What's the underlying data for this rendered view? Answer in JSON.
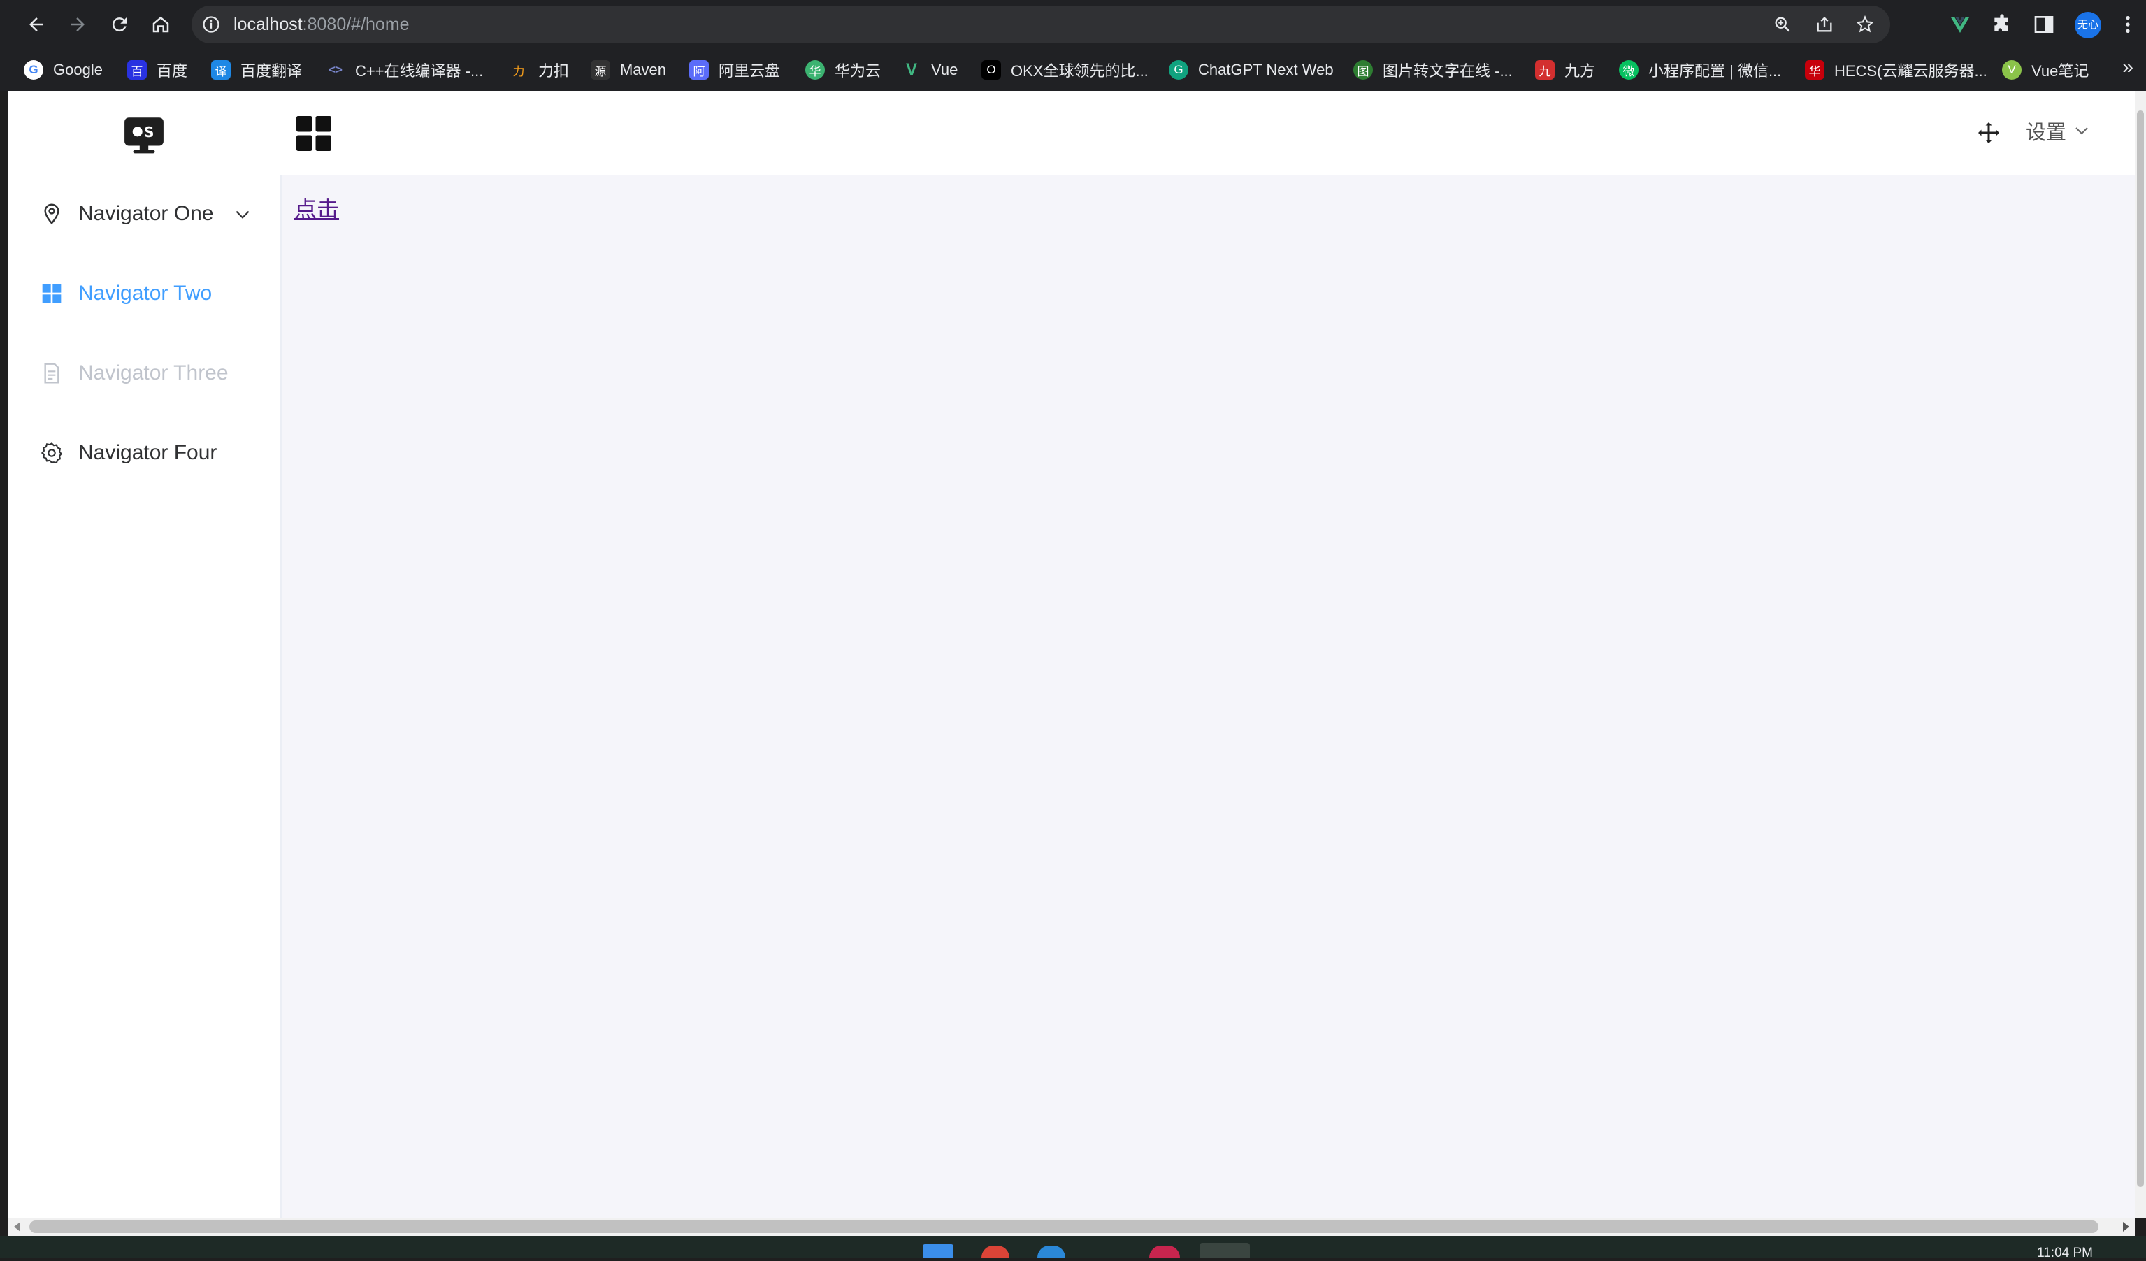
{
  "browser": {
    "url_host": "localhost",
    "url_rest": ":8080/#/home",
    "profile_label": "无心"
  },
  "bookmarks": [
    {
      "label": "Google",
      "glyph": "G",
      "color": "#ffffff"
    },
    {
      "label": "百度",
      "glyph": "百",
      "color": "#2932e1"
    },
    {
      "label": "百度翻译",
      "glyph": "译",
      "color": "#1e88e5"
    },
    {
      "label": "C++在线编译器 -...",
      "glyph": "<>",
      "color": "#5c6bc0"
    },
    {
      "label": "力扣",
      "glyph": "力",
      "color": "#f89f1b"
    },
    {
      "label": "Maven",
      "glyph": "源",
      "color": "#333333"
    },
    {
      "label": "阿里云盘",
      "glyph": "阿",
      "color": "#5b6cf9"
    },
    {
      "label": "华为云",
      "glyph": "华",
      "color": "#3cb371"
    },
    {
      "label": "Vue",
      "glyph": "V",
      "color": "#41b883"
    },
    {
      "label": "OKX全球领先的比...",
      "glyph": "O",
      "color": "#000000"
    },
    {
      "label": "ChatGPT Next Web",
      "glyph": "G",
      "color": "#10a37f"
    },
    {
      "label": "图片转文字在线 -...",
      "glyph": "图",
      "color": "#2e7d32"
    },
    {
      "label": "九方",
      "glyph": "九",
      "color": "#d32f2f"
    },
    {
      "label": "小程序配置 | 微信...",
      "glyph": "微",
      "color": "#07c160"
    },
    {
      "label": "HECS(云耀云服务器...",
      "glyph": "华",
      "color": "#c7000b"
    },
    {
      "label": "Vue笔记",
      "glyph": "V",
      "color": "#8bc34a"
    }
  ],
  "header": {
    "settings_label": "设置"
  },
  "sidebar": {
    "items": [
      {
        "label": "Navigator One",
        "state": "normal",
        "icon": "location-icon"
      },
      {
        "label": "Navigator Two",
        "state": "active",
        "icon": "menu-grid-icon"
      },
      {
        "label": "Navigator Three",
        "state": "disabled",
        "icon": "document-icon"
      },
      {
        "label": "Navigator Four",
        "state": "normal",
        "icon": "gear-icon"
      }
    ]
  },
  "main": {
    "link_label": "点击"
  },
  "taskbar": {
    "clock": "11:04 PM"
  },
  "colors": {
    "active": "#409eff",
    "disabled": "#c0c4cc",
    "text": "#303133",
    "link": "#551a8b"
  }
}
